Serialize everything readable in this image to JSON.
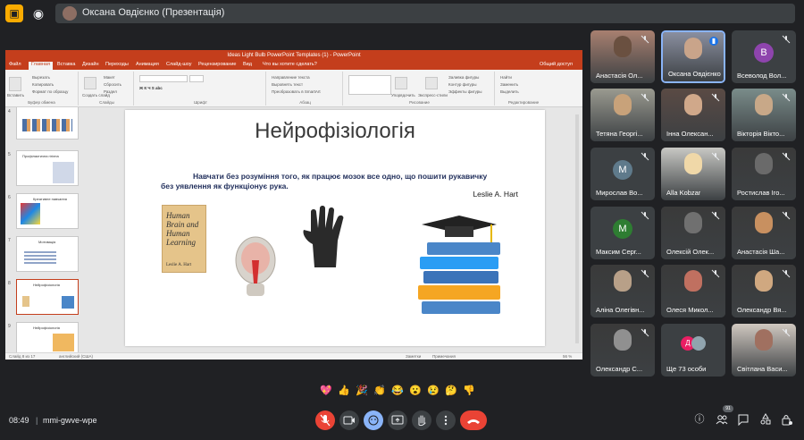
{
  "topbar": {
    "title": "Оксана Овдієнко (Презентація)"
  },
  "ppt": {
    "window_title": "Ideas Light Bulb PowerPoint Templates (1) - PowerPoint",
    "tabs": [
      "Файл",
      "Главная",
      "Вставка",
      "Дизайн",
      "Переходы",
      "Анимация",
      "Слайд-шоу",
      "Рецензирование",
      "Вид",
      "Что вы хотите сделать?",
      "Общий доступ"
    ],
    "ribbon": {
      "paste": "Вставить",
      "cut": "Вырезать",
      "copy": "Копировать",
      "format": "Формат по образцу",
      "clipboard": "Буфер обмена",
      "new_slide": "Создать слайд",
      "layout": "Макет",
      "reset": "Сбросить",
      "section": "Раздел",
      "slides": "Слайды",
      "font": "Шрифт",
      "text_dir": "Направление текста",
      "align_text": "Выровнять текст",
      "smartart": "Преобразовать в SmartArt",
      "paragraph": "Абзац",
      "arrange": "Упорядочить",
      "styles": "Экспресс-стили",
      "fill": "Заливка фигуры",
      "outline": "Контур фигуры",
      "effects": "Эффекты фигуры",
      "drawing": "Рисование",
      "find": "Найти",
      "replace": "Заменить",
      "select": "Выделить",
      "editing": "Редактирование"
    },
    "slide": {
      "title": "Нейрофізіологія",
      "quote": "Навчати без розуміння того, як працює мозок все одно, що пошити рукавичку без уявлення як функціонує рука.",
      "author": "Leslie A. Hart",
      "book_title": "Human Brain and Human Learning",
      "book_author": "Leslie A. Hart"
    },
    "thumb_numbers": [
      "4",
      "5",
      "6",
      "7",
      "8",
      "9"
    ],
    "thumb_texts": [
      "",
      "Профілактична гігієна",
      "Креативне навчання",
      "Мотивація",
      "Нейрофізіологія",
      "Нейрофізіологія"
    ],
    "status": {
      "slide": "Слайд 8 из 17",
      "lang": "английский (США)",
      "notes": "Заметки",
      "comments": "Примечания",
      "zoom": "56 %"
    }
  },
  "participants": [
    {
      "name": "Анастасія Ол...",
      "bubble": "",
      "bubble_color": ""
    },
    {
      "name": "Оксана Овдієнко",
      "bubble": "",
      "bubble_color": ""
    },
    {
      "name": "Всеволод Вол...",
      "bubble": "В",
      "bubble_color": "#8e44ad"
    },
    {
      "name": "Тетяна Георгі...",
      "bubble": "",
      "bubble_color": ""
    },
    {
      "name": "Інна Олексан...",
      "bubble": "",
      "bubble_color": ""
    },
    {
      "name": "Вікторія Вікто...",
      "bubble": "",
      "bubble_color": ""
    },
    {
      "name": "Мирослав Во...",
      "bubble": "М",
      "bubble_color": "#5f7a8b"
    },
    {
      "name": "Alla Kobzar",
      "bubble": "",
      "bubble_color": ""
    },
    {
      "name": "Ростислав Іго...",
      "bubble": "",
      "bubble_color": ""
    },
    {
      "name": "Максим Серг...",
      "bubble": "М",
      "bubble_color": "#2e7d32"
    },
    {
      "name": "Олексій Олек...",
      "bubble": "",
      "bubble_color": ""
    },
    {
      "name": "Анастасія Ша...",
      "bubble": "",
      "bubble_color": ""
    },
    {
      "name": "Аліна Олегівн...",
      "bubble": "",
      "bubble_color": ""
    },
    {
      "name": "Олеся Микол...",
      "bubble": "",
      "bubble_color": ""
    },
    {
      "name": "Олександр Вя...",
      "bubble": "",
      "bubble_color": ""
    },
    {
      "name": "Олександр С...",
      "bubble": "",
      "bubble_color": ""
    },
    {
      "name": "Ще 73 особи",
      "bubble": "Д",
      "bubble_color": "#e91e63"
    },
    {
      "name": "Світлана Васи...",
      "bubble": "",
      "bubble_color": ""
    }
  ],
  "reactions": [
    "💖",
    "👍",
    "🎉",
    "👏",
    "😂",
    "😮",
    "😢",
    "🤔",
    "👎"
  ],
  "bottom": {
    "time": "08:49",
    "separator": "|",
    "code": "mmi-gwve-wpe",
    "participant_count": "91"
  },
  "colors": {
    "ppt_accent": "#c43e1c",
    "meet_bg": "#202124",
    "tile_bg": "#3c4043",
    "danger": "#ea4335",
    "active": "#8ab4f8"
  }
}
